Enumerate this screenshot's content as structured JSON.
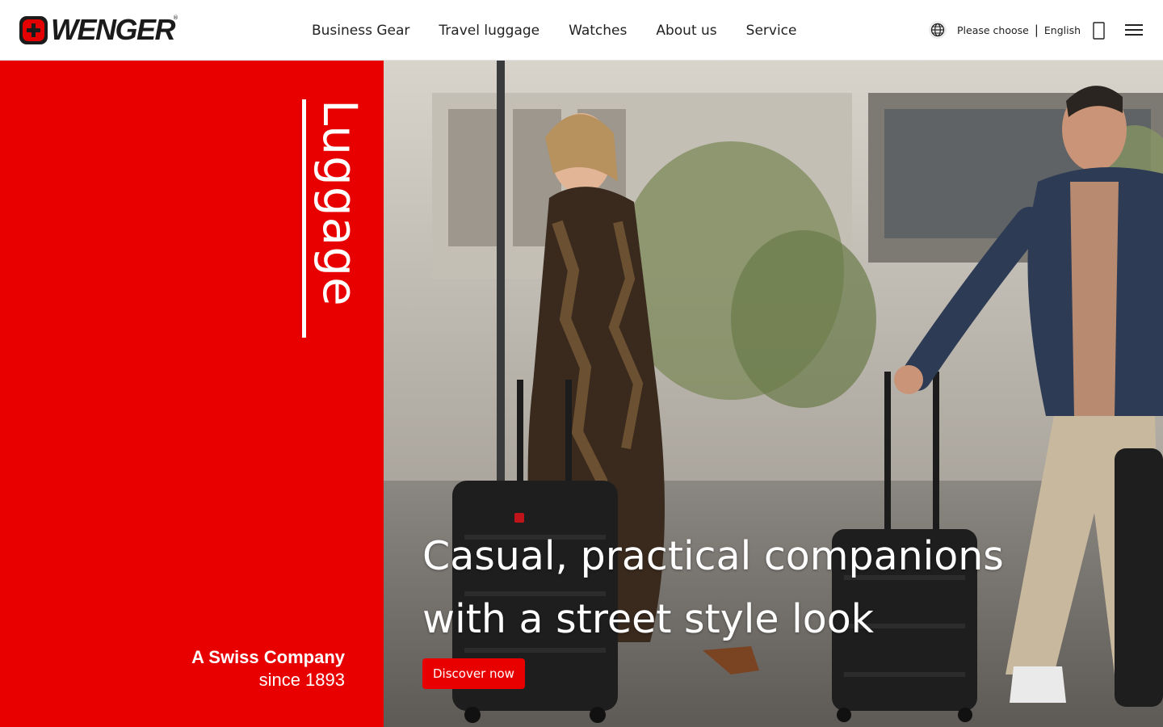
{
  "brand": {
    "logo_text": "WENGER",
    "registered": "®",
    "accent": "#e80000"
  },
  "nav": {
    "items": [
      {
        "label": "Business Gear"
      },
      {
        "label": "Travel luggage"
      },
      {
        "label": "Watches"
      },
      {
        "label": "About us"
      },
      {
        "label": "Service"
      }
    ]
  },
  "language": {
    "prompt": "Please choose",
    "separator": "|",
    "value": "English",
    "icon": "globe-icon"
  },
  "header_icons": {
    "cart": "cart-icon",
    "menu": "hamburger-menu-icon"
  },
  "side_panel": {
    "vertical_title": "Luggage",
    "tagline_line1": "A Swiss Company",
    "tagline_line2": "since 1893",
    "background": "#e80000"
  },
  "hero": {
    "headline_line1": "Casual, practical companions",
    "headline_line2": "with a street style look",
    "cta_label": "Discover now"
  }
}
